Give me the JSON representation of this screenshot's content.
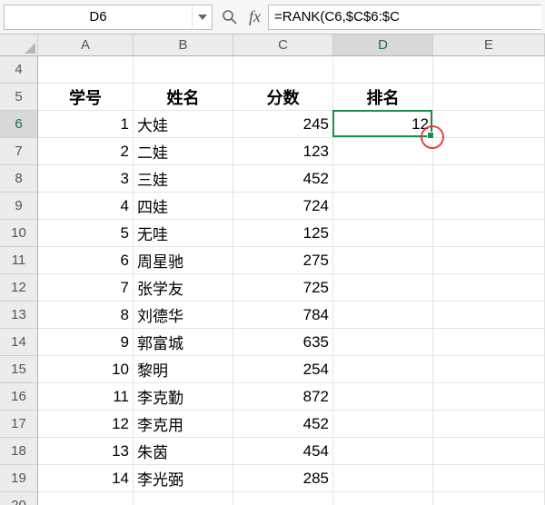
{
  "toolbar": {
    "name_box": "D6",
    "fx_label": "fx",
    "formula": "=RANK(C6,$C$6:$C"
  },
  "columns": [
    "A",
    "B",
    "C",
    "D",
    "E"
  ],
  "col_widths": {
    "A": 105,
    "B": 110,
    "C": 110,
    "D": 110,
    "E": 123
  },
  "row_start": 4,
  "row_end": 20,
  "active_cell": {
    "col": "D",
    "row": 6
  },
  "headers": {
    "A": "学号",
    "B": "姓名",
    "C": "分数",
    "D": "排名"
  },
  "rows": [
    {
      "r": 6,
      "A": 1,
      "B": "大娃",
      "C": 245,
      "D": 12
    },
    {
      "r": 7,
      "A": 2,
      "B": "二娃",
      "C": 123
    },
    {
      "r": 8,
      "A": 3,
      "B": "三娃",
      "C": 452
    },
    {
      "r": 9,
      "A": 4,
      "B": "四娃",
      "C": 724
    },
    {
      "r": 10,
      "A": 5,
      "B": "无哇",
      "C": 125
    },
    {
      "r": 11,
      "A": 6,
      "B": "周星驰",
      "C": 275
    },
    {
      "r": 12,
      "A": 7,
      "B": "张学友",
      "C": 725
    },
    {
      "r": 13,
      "A": 8,
      "B": "刘德华",
      "C": 784
    },
    {
      "r": 14,
      "A": 9,
      "B": "郭富城",
      "C": 635
    },
    {
      "r": 15,
      "A": 10,
      "B": "黎明",
      "C": 254
    },
    {
      "r": 16,
      "A": 11,
      "B": "李克勤",
      "C": 872
    },
    {
      "r": 17,
      "A": 12,
      "B": "李克用",
      "C": 452
    },
    {
      "r": 18,
      "A": 13,
      "B": "朱茵",
      "C": 454
    },
    {
      "r": 19,
      "A": 14,
      "B": "李光弼",
      "C": 285
    }
  ]
}
